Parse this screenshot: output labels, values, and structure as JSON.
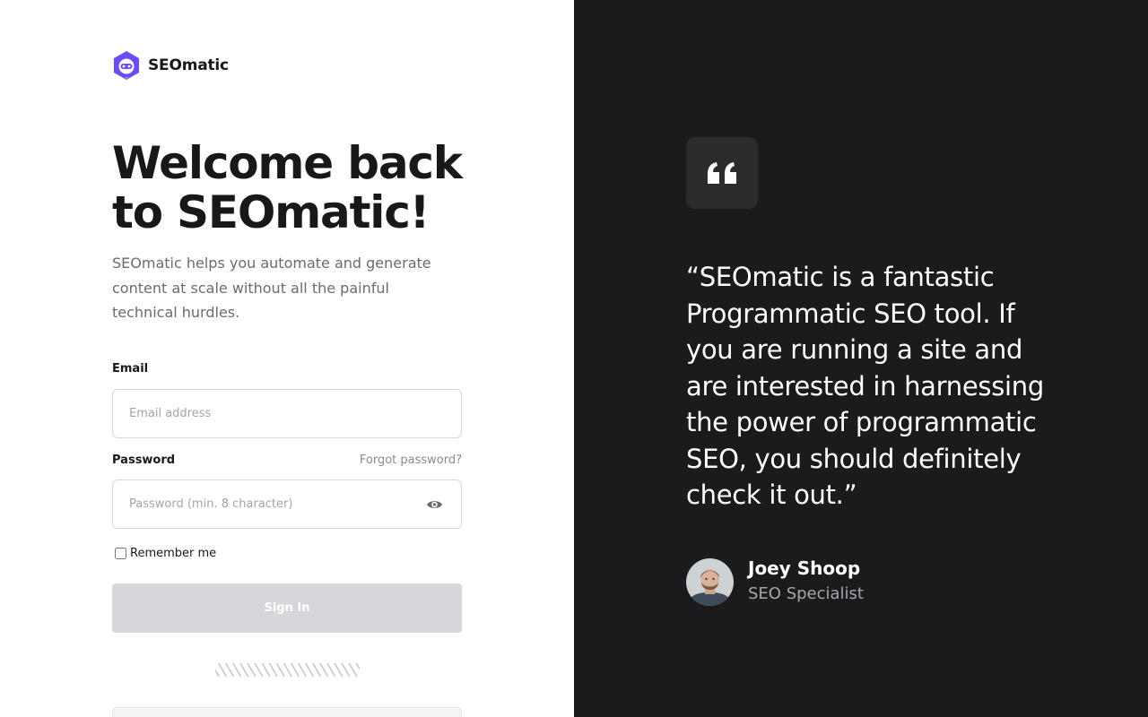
{
  "brand": {
    "name": "SEOmatic",
    "accent": "#6d4aff"
  },
  "login": {
    "heading": "Welcome back to SEOmatic!",
    "subtitle": "SEOmatic helps you automate and generate content at scale without all the painful technical hurdles.",
    "email": {
      "label": "Email",
      "placeholder": "Email address",
      "value": ""
    },
    "password": {
      "label": "Password",
      "placeholder": "Password (min. 8 character)",
      "value": "",
      "forgot_label": "Forgot password?",
      "toggle_icon": "eye-icon"
    },
    "remember_label": "Remember me",
    "remember_checked": false,
    "signin_label": "Sign In"
  },
  "testimonial": {
    "quote_icon": "quote-icon",
    "quote": "“SEOmatic is a fantastic Programmatic SEO tool. If you are running a site and are interested in harnessing the power of programmatic SEO, you should definitely check it out.”",
    "author_name": "Joey Shoop",
    "author_role": "SEO Specialist"
  },
  "colors": {
    "left_bg": "#ffffff",
    "right_bg": "#1b1b1d",
    "button_disabled": "#d7d7db"
  }
}
